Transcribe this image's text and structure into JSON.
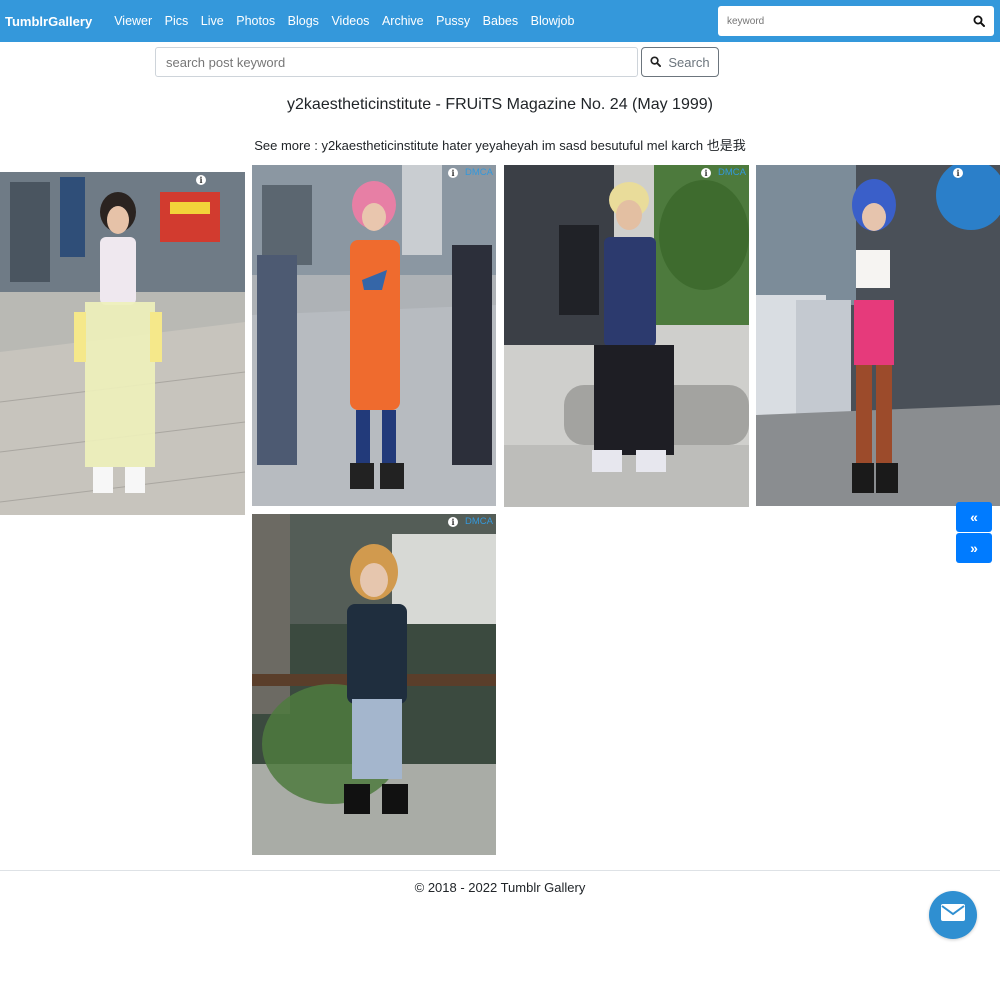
{
  "navbar": {
    "brand": "TumblrGallery",
    "links": [
      "Viewer",
      "Pics",
      "Live",
      "Photos",
      "Blogs",
      "Videos",
      "Archive",
      "Pussy",
      "Babes",
      "Blowjob"
    ],
    "search_placeholder": "keyword",
    "search_icon": "search-icon"
  },
  "post_search": {
    "placeholder": "search post keyword",
    "button_label": "Search",
    "button_icon": "search-icon"
  },
  "post": {
    "title": "y2kaestheticinstitute - FRUiTS Magazine No. 24 (May 1999)",
    "see_more_label": "See more :",
    "tags": [
      "y2kaestheticinstitute",
      "hater",
      "yeyaheyah",
      "im",
      "sasd",
      "besutuful",
      "mel",
      "karch",
      "也是我"
    ]
  },
  "gallery": {
    "dmca_label": "DMCA",
    "info_glyph": "i",
    "photos": [
      {
        "subject": "street fashion photo 1",
        "show_dmca": false
      },
      {
        "subject": "street fashion photo 2",
        "show_dmca": true
      },
      {
        "subject": "street fashion photo 3",
        "show_dmca": true
      },
      {
        "subject": "street fashion photo 4",
        "show_dmca": false
      },
      {
        "subject": "street fashion photo 5",
        "show_dmca": true
      }
    ]
  },
  "pagination": {
    "prev_label": "«",
    "next_label": "»"
  },
  "footer": {
    "copyright": "© 2018 - 2022 Tumblr Gallery"
  },
  "floating": {
    "mail_icon": "envelope-icon"
  },
  "colors": {
    "navbar": "#3498db",
    "page_button": "#007bff",
    "mail_button": "#2f8fd1",
    "dmca": "#3498db"
  }
}
